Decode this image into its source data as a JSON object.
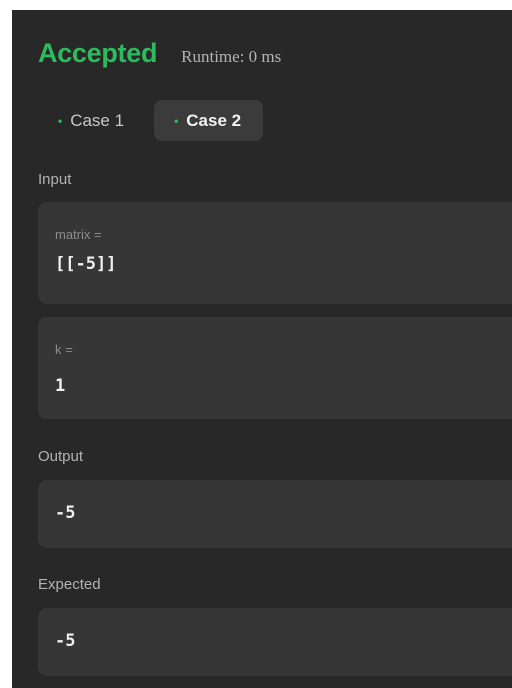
{
  "result": {
    "status": "Accepted",
    "runtime": "Runtime: 0 ms"
  },
  "tabs": [
    {
      "label": "Case 1",
      "active": false
    },
    {
      "label": "Case 2",
      "active": true
    }
  ],
  "input": {
    "label": "Input",
    "params": [
      {
        "name": "matrix =",
        "value": "[[-5]]"
      },
      {
        "name": "k =",
        "value": "1"
      }
    ]
  },
  "output": {
    "label": "Output",
    "value": "-5"
  },
  "expected": {
    "label": "Expected",
    "value": "-5"
  },
  "colors": {
    "accepted": "#2cbb5d",
    "background": "#282828",
    "box": "#363636"
  }
}
